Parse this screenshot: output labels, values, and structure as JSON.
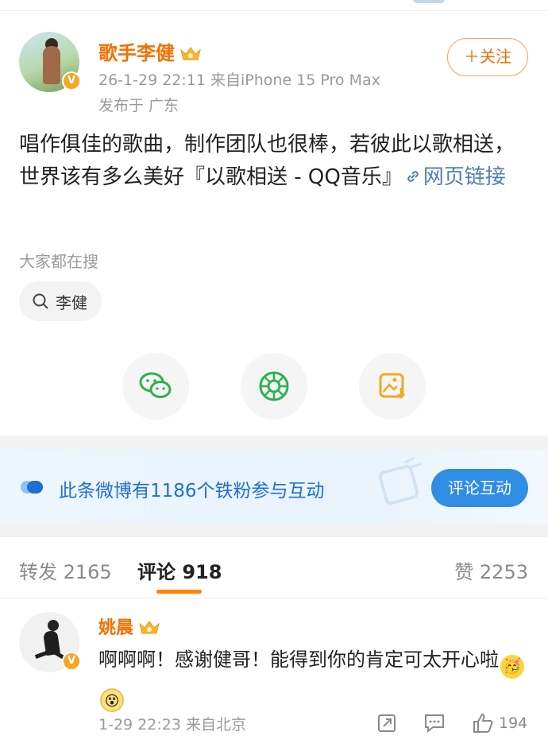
{
  "post": {
    "author": {
      "name": "歌手李健",
      "badge_icon": "crown-badge-icon",
      "verified_icon": "verified-badge-icon"
    },
    "timestamp": "26-1-29 22:11",
    "source": "来自iPhone 15 Pro Max",
    "location": "发布于 广东",
    "follow_label": "＋关注",
    "text_main": "唱作俱佳的歌曲，制作团队也很棒，若彼此以歌相送，世界该有多么美好『以歌相送 - QQ音乐』",
    "link_label": "网页链接",
    "link_icon": "link-icon"
  },
  "search": {
    "title": "大家都在搜",
    "chip_label": "李健",
    "chip_icon": "search-icon"
  },
  "share_buttons": [
    {
      "icon": "wechat-icon",
      "color": "#2bb24c"
    },
    {
      "icon": "moments-icon",
      "color": "#2bb24c"
    },
    {
      "icon": "save-image-icon",
      "color": "#f5a623"
    }
  ],
  "fan_banner": {
    "text": "此条微博有1186个铁粉参与互动",
    "button_label": "评论互动",
    "accent": "#2f8de4"
  },
  "tabs": {
    "repost": "转发 2165",
    "comments": "评论 918",
    "likes": "赞 2253",
    "active_color": "#ff8200"
  },
  "comment": {
    "name": "姚晨",
    "text": "啊啊啊！感谢健哥！能得到你的肯定可太开心啦",
    "emojis": [
      "party-face-emoji",
      "dizzy-face-emoji"
    ],
    "meta": "1-29 22:23 来自北京",
    "like_count": "194"
  },
  "colors": {
    "name_orange": "#f36f00",
    "link_blue": "#4e7fb3",
    "meta_gray": "#999999"
  }
}
